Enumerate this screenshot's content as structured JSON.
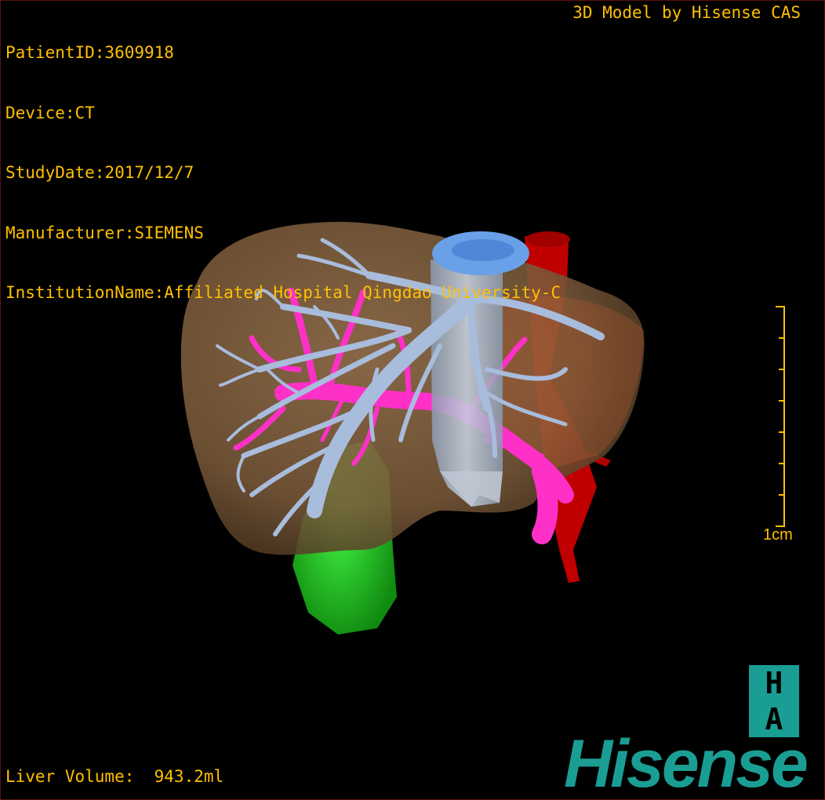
{
  "header": {
    "patient_id": "PatientID:3609918",
    "device": "Device:CT",
    "study_date": "StudyDate:2017/12/7",
    "manufacturer": "Manufacturer:SIEMENS",
    "institution": "InstitutionName:Affiliated Hospital Qingdao University-C",
    "model_credit": "3D Model by Hisense CAS"
  },
  "footer": {
    "liver_volume": "Liver Volume:  943.2ml"
  },
  "scale": {
    "label": "1cm"
  },
  "branding": {
    "badge_top": "H",
    "badge_bottom": "A",
    "logo_text": "Hisense"
  },
  "colors": {
    "overlay_text": "#ffc000",
    "brand": "#1a9e94",
    "liver": "#7a5a3a",
    "hepatic_vein": "#a8bcdc",
    "portal_vein": "#ff30c8",
    "gallbladder": "#22cc22",
    "aorta": "#cc0000",
    "ivc_cap": "#6aa0e8"
  },
  "icons": {
    "scale_bar": "scale-ruler-icon",
    "badge": "ha-badge-icon"
  }
}
